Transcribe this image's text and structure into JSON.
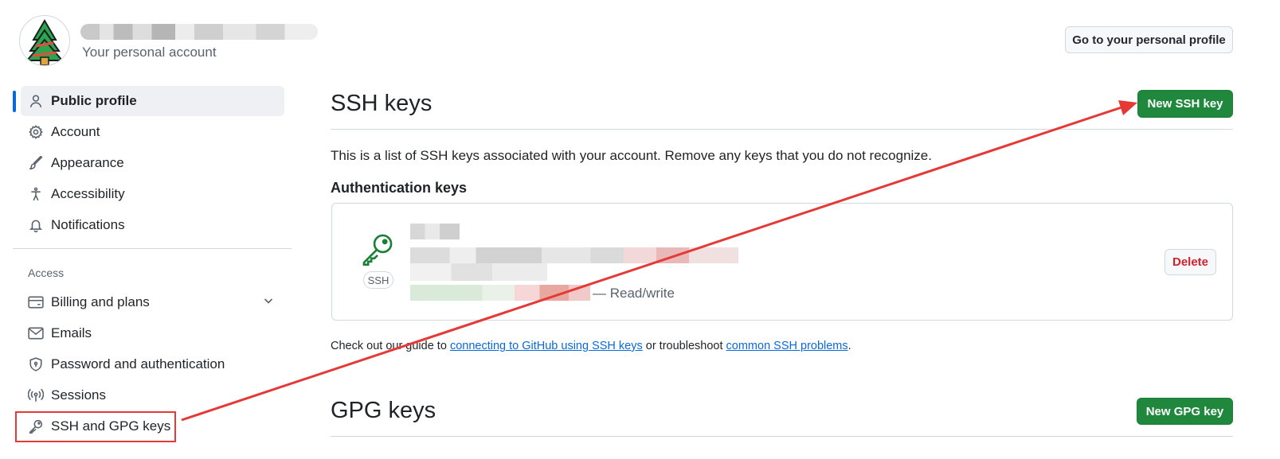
{
  "header": {
    "account_subtitle": "Your personal account",
    "profile_button": "Go to your personal profile"
  },
  "sidebar": {
    "items": [
      {
        "label": "Public profile",
        "icon": "person-icon",
        "active": true
      },
      {
        "label": "Account",
        "icon": "gear-icon"
      },
      {
        "label": "Appearance",
        "icon": "paintbrush-icon"
      },
      {
        "label": "Accessibility",
        "icon": "accessibility-icon"
      },
      {
        "label": "Notifications",
        "icon": "bell-icon"
      }
    ],
    "section_label": "Access",
    "access_items": [
      {
        "label": "Billing and plans",
        "icon": "credit-card-icon",
        "expandable": true
      },
      {
        "label": "Emails",
        "icon": "mail-icon"
      },
      {
        "label": "Password and authentication",
        "icon": "shield-lock-icon"
      },
      {
        "label": "Sessions",
        "icon": "broadcast-icon"
      },
      {
        "label": "SSH and GPG keys",
        "icon": "key-icon",
        "highlighted": true
      }
    ]
  },
  "main": {
    "ssh_title": "SSH keys",
    "new_ssh_button": "New SSH key",
    "description": "This is a list of SSH keys associated with your account. Remove any keys that you do not recognize.",
    "auth_keys_heading": "Authentication keys",
    "key": {
      "type_badge": "SSH",
      "access": "— Read/write",
      "delete_button": "Delete"
    },
    "guide": {
      "prefix": "Check out our guide to ",
      "link1": "connecting to GitHub using SSH keys",
      "middle": " or troubleshoot ",
      "link2": "common SSH problems",
      "suffix": "."
    },
    "gpg_title": "GPG keys",
    "new_gpg_button": "New GPG key"
  },
  "colors": {
    "accent_blue": "#0969da",
    "primary_green": "#1f883d",
    "danger_red": "#cf222e",
    "annotation_red": "#e53935"
  }
}
